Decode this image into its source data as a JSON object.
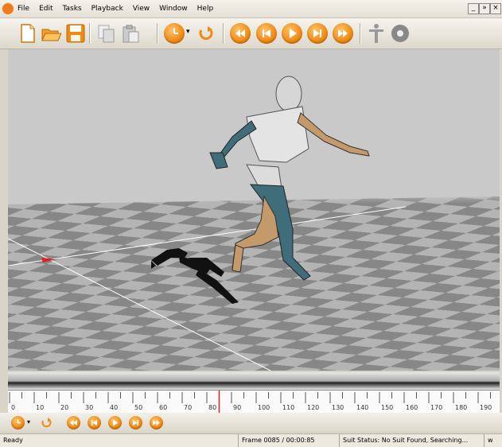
{
  "menu": {
    "items": [
      "File",
      "Edit",
      "Tasks",
      "Playback",
      "View",
      "Window",
      "Help"
    ],
    "window_controls": [
      "_",
      "»",
      "×"
    ]
  },
  "toolbar": {
    "icons": [
      "new-file-icon",
      "open-folder-icon",
      "save-icon",
      "copy-icon",
      "paste-icon",
      "record-timer-icon",
      "loop-icon",
      "rewind-icon",
      "previous-frame-icon",
      "play-icon",
      "next-frame-icon",
      "fast-forward-icon",
      "figure-icon",
      "disc-icon"
    ],
    "timer_dropdown_arrow": "▾"
  },
  "timeline": {
    "labels": [
      "0",
      "10",
      "20",
      "30",
      "40",
      "50",
      "60",
      "70",
      "80",
      "90",
      "100",
      "110",
      "120",
      "130",
      "140",
      "150",
      "160",
      "170",
      "180",
      "190"
    ],
    "current_frame_marker": 85
  },
  "playbar": {
    "icons": [
      "record-timer-icon",
      "loop-icon",
      "rewind-icon",
      "previous-frame-icon",
      "play-icon",
      "next-frame-icon",
      "fast-forward-icon"
    ],
    "timer_dropdown_arrow": "▾"
  },
  "status": {
    "left": "Ready",
    "frame": "Frame 0085 / 00:00:85",
    "suit": "Suit Status: No Suit Found, Searching...",
    "extra": "w"
  },
  "colors": {
    "accent": "#f08a14",
    "floor_light": "#b8b8b8",
    "floor_dark": "#8a8a8a",
    "sky": "#c9c9c9",
    "marker_red": "#e02020"
  }
}
